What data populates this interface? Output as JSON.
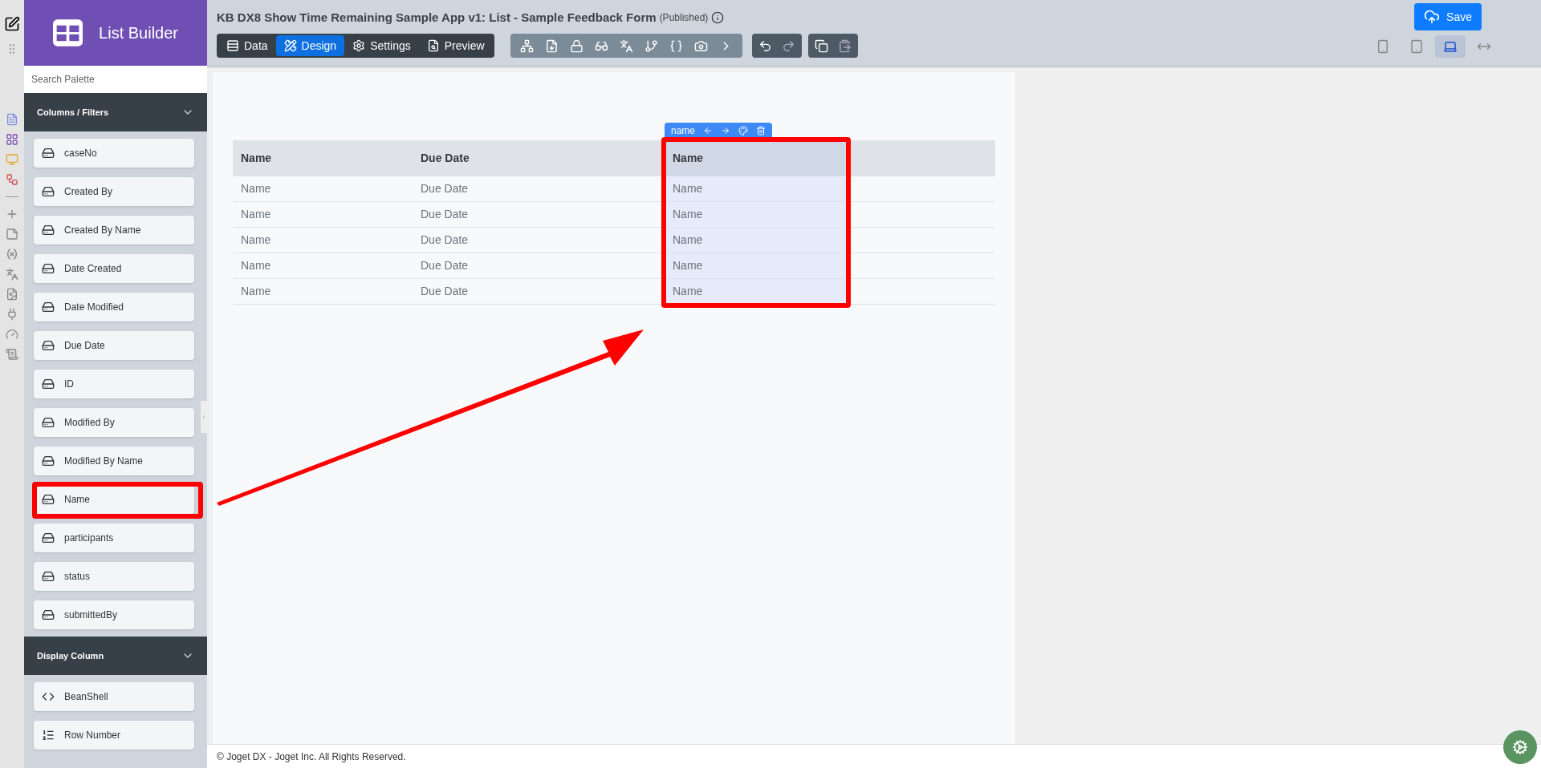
{
  "app": {
    "name": "List Builder"
  },
  "header": {
    "title": "KB DX8 Show Time Remaining Sample App v1: List - Sample Feedback Form",
    "status": "(Published)",
    "save_label": "Save"
  },
  "tabs": [
    {
      "label": "Data",
      "selected": false
    },
    {
      "label": "Design",
      "selected": true
    },
    {
      "label": "Settings",
      "selected": false
    },
    {
      "label": "Preview",
      "selected": false
    }
  ],
  "devices": [
    {
      "kind": "phone",
      "selected": false
    },
    {
      "kind": "tablet",
      "selected": false
    },
    {
      "kind": "laptop",
      "selected": true
    },
    {
      "kind": "wide",
      "selected": false
    }
  ],
  "palette": {
    "search_placeholder": "Search Palette",
    "sections": [
      {
        "title": "Columns / Filters",
        "expanded": true,
        "items": [
          {
            "label": "caseNo",
            "kind": "field",
            "highlighted": false
          },
          {
            "label": "Created By",
            "kind": "field",
            "highlighted": false
          },
          {
            "label": "Created By Name",
            "kind": "field",
            "highlighted": false
          },
          {
            "label": "Date Created",
            "kind": "field",
            "highlighted": false
          },
          {
            "label": "Date Modified",
            "kind": "field",
            "highlighted": false
          },
          {
            "label": "Due Date",
            "kind": "field",
            "highlighted": false
          },
          {
            "label": "ID",
            "kind": "field",
            "highlighted": false
          },
          {
            "label": "Modified By",
            "kind": "field",
            "highlighted": false
          },
          {
            "label": "Modified By Name",
            "kind": "field",
            "highlighted": false
          },
          {
            "label": "Name",
            "kind": "field",
            "highlighted": true
          },
          {
            "label": "participants",
            "kind": "field",
            "highlighted": false
          },
          {
            "label": "status",
            "kind": "field",
            "highlighted": false
          },
          {
            "label": "submittedBy",
            "kind": "field",
            "highlighted": false
          }
        ]
      },
      {
        "title": "Display Column",
        "expanded": true,
        "items": [
          {
            "label": "BeanShell",
            "kind": "code",
            "highlighted": false
          },
          {
            "label": "Row Number",
            "kind": "number",
            "highlighted": false
          }
        ]
      }
    ]
  },
  "table": {
    "columns": [
      {
        "label": "Name",
        "selected": false,
        "highlighted": false
      },
      {
        "label": "Due Date",
        "selected": false,
        "highlighted": false
      },
      {
        "label": "Name",
        "selected": true,
        "highlighted": true,
        "toolbar_label": "name"
      }
    ],
    "rows": [
      [
        "Name",
        "Due Date",
        "Name"
      ],
      [
        "Name",
        "Due Date",
        "Name"
      ],
      [
        "Name",
        "Due Date",
        "Name"
      ],
      [
        "Name",
        "Due Date",
        "Name"
      ],
      [
        "Name",
        "Due Date",
        "Name"
      ]
    ]
  },
  "footer": "© Joget DX - Joget Inc. All Rights Reserved."
}
